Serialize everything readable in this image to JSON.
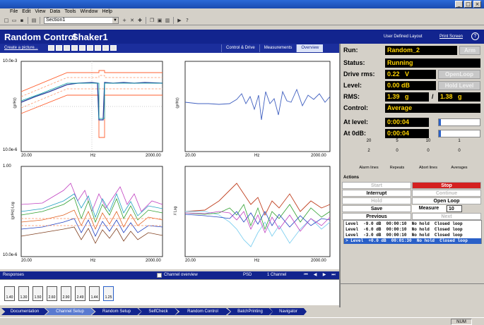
{
  "menu": [
    "File",
    "Edit",
    "View",
    "Data",
    "Tools",
    "Window",
    "Help"
  ],
  "toolbar": {
    "section_value": "Section1"
  },
  "header": {
    "mode": "Random Control",
    "device": "Shaker1",
    "layout_label": "User Defined Layout",
    "print_label": "Print Screen",
    "help_label": "?"
  },
  "subheader": {
    "create_picture": "Create a picture...",
    "tabs": [
      "Control & Drive",
      "Measurements",
      "Overview"
    ]
  },
  "graphs": {
    "g1": {
      "ytop": "10.0e-3",
      "ybot": "10.0e-6",
      "xmin": "20.00",
      "xmid": "Hz",
      "xmax": "2000.00",
      "yname": "(g²/Hz)"
    },
    "g2": {
      "xmin": "20.00",
      "xmid": "Hz",
      "xmax": "2000.00",
      "yname": "(g²/Hz)"
    },
    "g3": {
      "ytop": "1.00",
      "ybot": "10.0e-6",
      "xmin": "20.00",
      "xmid": "Hz",
      "xmax": "2000.00",
      "yname": "(g²/Hz) Log"
    },
    "g4": {
      "xmin": "20.00",
      "xmid": "Hz",
      "xmax": "2000.00",
      "yname": "// Log"
    }
  },
  "responses": {
    "label": "Responses",
    "overview_label": "Channel overview",
    "psd": "PSD",
    "channels": "1 Channel"
  },
  "thumbs": [
    "1.40",
    "1.30",
    "1.50",
    "2.60",
    "2.90",
    "2.49",
    "1.44",
    "1.25"
  ],
  "workflow": [
    "Documentation",
    "Channel Setup",
    "Random Setup",
    "SelfCheck",
    "Random Control",
    "BatchPrinting",
    "Navigator"
  ],
  "status": {
    "num": "NUM"
  },
  "run": {
    "run_label": "Run:",
    "run_value": "Random_2",
    "arm": "Arm",
    "status_label": "Status:",
    "status_value": "Running",
    "drive_label": "Drive rms:",
    "drive_value": "0.22",
    "drive_unit": "V",
    "openloop": "OpenLoop",
    "level_label": "Level:",
    "level_value": "0.00 dB",
    "holdlevel": "Hold Level",
    "rms_label": "RMS:",
    "rms_value": "1.39",
    "rms_unit": "g",
    "rms_sep": "/",
    "rms_value2": "1.38",
    "rms_unit2": "g",
    "control_label": "Control:",
    "control_value": "Average",
    "atlevel_label": "At level:",
    "atlevel_value": "0:00:04",
    "at0db_label": "At 0dB:",
    "at0db_value": "0:00:04"
  },
  "sliders": [
    {
      "top": "20",
      "bottom": "2",
      "label": "Alarm lines"
    },
    {
      "top": "5",
      "bottom": "0",
      "label": "Repeats"
    },
    {
      "top": "10",
      "bottom": "0",
      "label": "Abort lines"
    },
    {
      "top": "1",
      "bottom": "0",
      "label": "Averages"
    }
  ],
  "actions": {
    "title": "Actions",
    "start": "Start",
    "stop": "Stop",
    "interrupt": "Interrupt",
    "continue": "Continue",
    "hold": "Hold",
    "openloop": "Open Loop",
    "save": "Save",
    "measure_label": "Measure",
    "measure_value": "10",
    "previous": "Previous",
    "next": "Next"
  },
  "levels": [
    "Level  -9.0 dB  00:00:10  No hold  Closed loop",
    "Level  -6.0 dB  00:00:10  No hold  Closed loop",
    "Level  -3.0 dB  00:00:10  No hold  Closed loop",
    "> Level  +0.0 dB  00:01:30  No hold  Closed loop"
  ],
  "colors": {
    "header": "#12248e",
    "accent": "#ffd400",
    "stop": "#d42020"
  }
}
